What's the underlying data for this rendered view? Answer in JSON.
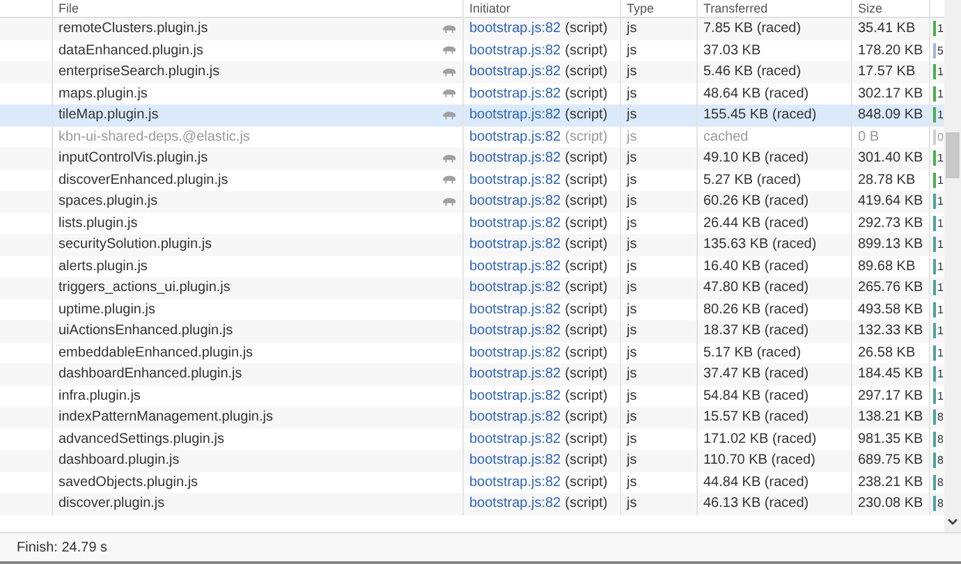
{
  "columns": [
    "File",
    "Initiator",
    "Type",
    "Transferred",
    "Size"
  ],
  "rows": [
    {
      "file": "remoteClusters.plugin.js",
      "throttled": true,
      "initiator": "bootstrap.js:82",
      "cause": "(script)",
      "type": "js",
      "transferred": "7.85 KB (raced)",
      "size": "35.41 KB",
      "timing": "1",
      "color": "#4caf50",
      "selected": false,
      "dimmed": false
    },
    {
      "file": "dataEnhanced.plugin.js",
      "throttled": true,
      "initiator": "bootstrap.js:82",
      "cause": "(script)",
      "type": "js",
      "transferred": "37.03 KB",
      "size": "178.20 KB",
      "timing": "5",
      "color": "#9db8d9",
      "selected": false,
      "dimmed": false
    },
    {
      "file": "enterpriseSearch.plugin.js",
      "throttled": true,
      "initiator": "bootstrap.js:82",
      "cause": "(script)",
      "type": "js",
      "transferred": "5.46 KB (raced)",
      "size": "17.57 KB",
      "timing": "1",
      "color": "#4caf50",
      "selected": false,
      "dimmed": false
    },
    {
      "file": "maps.plugin.js",
      "throttled": true,
      "initiator": "bootstrap.js:82",
      "cause": "(script)",
      "type": "js",
      "transferred": "48.64 KB (raced)",
      "size": "302.17 KB",
      "timing": "1",
      "color": "#4caf50",
      "selected": false,
      "dimmed": false
    },
    {
      "file": "tileMap.plugin.js",
      "throttled": true,
      "initiator": "bootstrap.js:82",
      "cause": "(script)",
      "type": "js",
      "transferred": "155.45 KB (raced)",
      "size": "848.09 KB",
      "timing": "1",
      "color": "#4caf50",
      "selected": true,
      "dimmed": false
    },
    {
      "file": "kbn-ui-shared-deps.@elastic.js",
      "throttled": false,
      "initiator": "bootstrap.js:82",
      "cause": "(script)",
      "type": "js",
      "transferred": "cached",
      "size": "0 B",
      "timing": "0",
      "color": "#d0d0d0",
      "selected": false,
      "dimmed": true
    },
    {
      "file": "inputControlVis.plugin.js",
      "throttled": true,
      "initiator": "bootstrap.js:82",
      "cause": "(script)",
      "type": "js",
      "transferred": "49.10 KB (raced)",
      "size": "301.40 KB",
      "timing": "1",
      "color": "#4caf50",
      "selected": false,
      "dimmed": false
    },
    {
      "file": "discoverEnhanced.plugin.js",
      "throttled": true,
      "initiator": "bootstrap.js:82",
      "cause": "(script)",
      "type": "js",
      "transferred": "5.27 KB (raced)",
      "size": "28.78 KB",
      "timing": "1",
      "color": "#4caf50",
      "selected": false,
      "dimmed": false
    },
    {
      "file": "spaces.plugin.js",
      "throttled": true,
      "initiator": "bootstrap.js:82",
      "cause": "(script)",
      "type": "js",
      "transferred": "60.26 KB (raced)",
      "size": "419.64 KB",
      "timing": "1",
      "color": "#4fa39a",
      "selected": false,
      "dimmed": false
    },
    {
      "file": "lists.plugin.js",
      "throttled": false,
      "initiator": "bootstrap.js:82",
      "cause": "(script)",
      "type": "js",
      "transferred": "26.44 KB (raced)",
      "size": "292.73 KB",
      "timing": "1",
      "color": "#4fa39a",
      "selected": false,
      "dimmed": false
    },
    {
      "file": "securitySolution.plugin.js",
      "throttled": false,
      "initiator": "bootstrap.js:82",
      "cause": "(script)",
      "type": "js",
      "transferred": "135.63 KB (raced)",
      "size": "899.13 KB",
      "timing": "1",
      "color": "#4fa39a",
      "selected": false,
      "dimmed": false
    },
    {
      "file": "alerts.plugin.js",
      "throttled": false,
      "initiator": "bootstrap.js:82",
      "cause": "(script)",
      "type": "js",
      "transferred": "16.40 KB (raced)",
      "size": "89.68 KB",
      "timing": "1",
      "color": "#4fa39a",
      "selected": false,
      "dimmed": false
    },
    {
      "file": "triggers_actions_ui.plugin.js",
      "throttled": false,
      "initiator": "bootstrap.js:82",
      "cause": "(script)",
      "type": "js",
      "transferred": "47.80 KB (raced)",
      "size": "265.76 KB",
      "timing": "1",
      "color": "#4fa39a",
      "selected": false,
      "dimmed": false
    },
    {
      "file": "uptime.plugin.js",
      "throttled": false,
      "initiator": "bootstrap.js:82",
      "cause": "(script)",
      "type": "js",
      "transferred": "80.26 KB (raced)",
      "size": "493.58 KB",
      "timing": "1",
      "color": "#4fa39a",
      "selected": false,
      "dimmed": false
    },
    {
      "file": "uiActionsEnhanced.plugin.js",
      "throttled": false,
      "initiator": "bootstrap.js:82",
      "cause": "(script)",
      "type": "js",
      "transferred": "18.37 KB (raced)",
      "size": "132.33 KB",
      "timing": "1",
      "color": "#4fa39a",
      "selected": false,
      "dimmed": false
    },
    {
      "file": "embeddableEnhanced.plugin.js",
      "throttled": false,
      "initiator": "bootstrap.js:82",
      "cause": "(script)",
      "type": "js",
      "transferred": "5.17 KB (raced)",
      "size": "26.58 KB",
      "timing": "1",
      "color": "#4fa39a",
      "selected": false,
      "dimmed": false
    },
    {
      "file": "dashboardEnhanced.plugin.js",
      "throttled": false,
      "initiator": "bootstrap.js:82",
      "cause": "(script)",
      "type": "js",
      "transferred": "37.47 KB (raced)",
      "size": "184.45 KB",
      "timing": "1",
      "color": "#4fa39a",
      "selected": false,
      "dimmed": false
    },
    {
      "file": "infra.plugin.js",
      "throttled": false,
      "initiator": "bootstrap.js:82",
      "cause": "(script)",
      "type": "js",
      "transferred": "54.84 KB (raced)",
      "size": "297.17 KB",
      "timing": "1",
      "color": "#4fa39a",
      "selected": false,
      "dimmed": false
    },
    {
      "file": "indexPatternManagement.plugin.js",
      "throttled": false,
      "initiator": "bootstrap.js:82",
      "cause": "(script)",
      "type": "js",
      "transferred": "15.57 KB (raced)",
      "size": "138.21 KB",
      "timing": "8",
      "color": "#4fa39a",
      "selected": false,
      "dimmed": false
    },
    {
      "file": "advancedSettings.plugin.js",
      "throttled": false,
      "initiator": "bootstrap.js:82",
      "cause": "(script)",
      "type": "js",
      "transferred": "171.02 KB (raced)",
      "size": "981.35 KB",
      "timing": "8",
      "color": "#4fa39a",
      "selected": false,
      "dimmed": false
    },
    {
      "file": "dashboard.plugin.js",
      "throttled": false,
      "initiator": "bootstrap.js:82",
      "cause": "(script)",
      "type": "js",
      "transferred": "110.70 KB (raced)",
      "size": "689.75 KB",
      "timing": "8",
      "color": "#4fa39a",
      "selected": false,
      "dimmed": false
    },
    {
      "file": "savedObjects.plugin.js",
      "throttled": false,
      "initiator": "bootstrap.js:82",
      "cause": "(script)",
      "type": "js",
      "transferred": "44.84 KB (raced)",
      "size": "238.21 KB",
      "timing": "8",
      "color": "#4fa39a",
      "selected": false,
      "dimmed": false
    },
    {
      "file": "discover.plugin.js",
      "throttled": false,
      "initiator": "bootstrap.js:82",
      "cause": "(script)",
      "type": "js",
      "transferred": "46.13 KB (raced)",
      "size": "230.08 KB",
      "timing": "8",
      "color": "#4fa39a",
      "selected": false,
      "dimmed": false
    }
  ],
  "status_bar": "Finish: 24.79 s"
}
